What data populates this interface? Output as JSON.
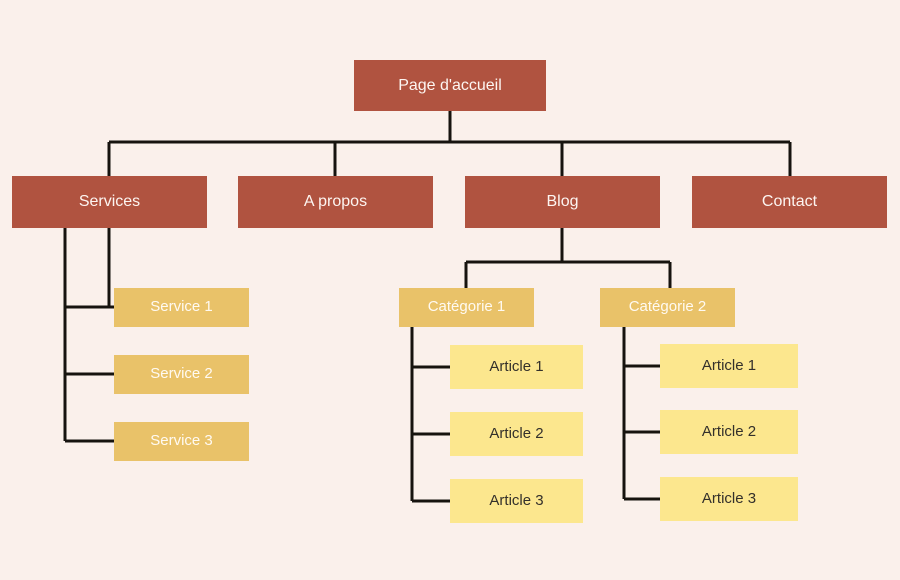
{
  "diagram": {
    "title": "Site map tree diagram",
    "type": "tree",
    "background_color": "#faf0eb",
    "connector_color": "#16130f",
    "palette": {
      "root": "#b05340",
      "section": "#b05340",
      "gold": "#e9c269",
      "pale": "#fce78e",
      "text_light": "#fdf5f1",
      "text_dark": "#33302b"
    }
  },
  "nodes": {
    "root": {
      "label": "Page d'accueil"
    },
    "sections": [
      {
        "label": "Services"
      },
      {
        "label": "A propos"
      },
      {
        "label": "Blog"
      },
      {
        "label": "Contact"
      }
    ],
    "services_children": [
      {
        "label": "Service 1"
      },
      {
        "label": "Service 2"
      },
      {
        "label": "Service 3"
      }
    ],
    "blog_categories": [
      {
        "label": "Catégorie 1"
      },
      {
        "label": "Catégorie 2"
      }
    ],
    "category1_articles": [
      {
        "label": "Article 1"
      },
      {
        "label": "Article 2"
      },
      {
        "label": "Article 3"
      }
    ],
    "category2_articles": [
      {
        "label": "Article 1"
      },
      {
        "label": "Article 2"
      },
      {
        "label": "Article 3"
      }
    ]
  }
}
